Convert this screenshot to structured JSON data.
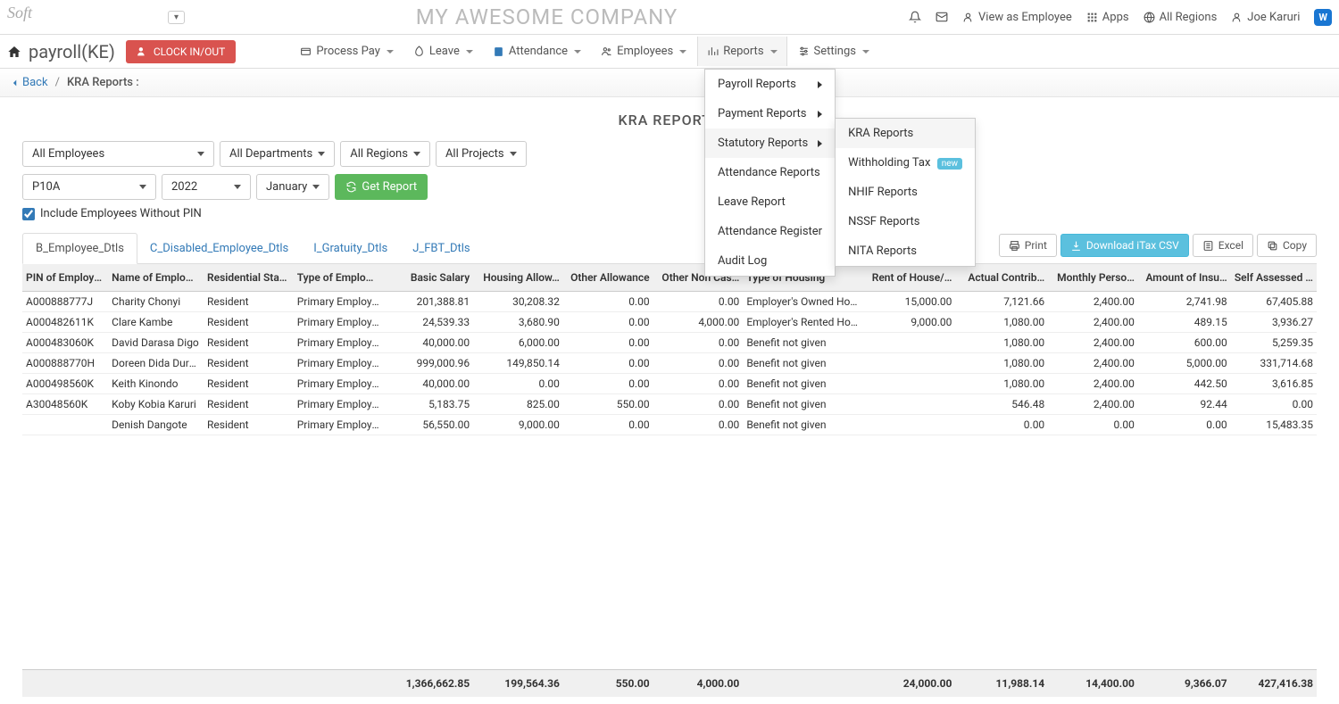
{
  "topbar": {
    "company": "MY AWESOME COMPANY",
    "view_as": "View as Employee",
    "apps": "Apps",
    "regions": "All Regions",
    "user": "Joe Karuri",
    "chat": "W"
  },
  "navbar": {
    "module": "payroll(KE)",
    "clock": "CLOCK IN/OUT",
    "menus": {
      "process": "Process Pay",
      "leave": "Leave",
      "attendance": "Attendance",
      "employees": "Employees",
      "reports": "Reports",
      "settings": "Settings"
    }
  },
  "dropdown": {
    "payroll_reports": "Payroll Reports",
    "payment_reports": "Payment Reports",
    "statutory_reports": "Statutory Reports",
    "attendance_reports": "Attendance Reports",
    "leave_report": "Leave Report",
    "attendance_register": "Attendance Register",
    "audit_log": "Audit Log",
    "sub": {
      "kra": "KRA Reports",
      "withholding": "Withholding Tax",
      "withholding_badge": "new",
      "nhif": "NHIF Reports",
      "nssf": "NSSF Reports",
      "nita": "NITA Reports"
    }
  },
  "breadcrumb": {
    "back": "Back",
    "current": "KRA Reports :"
  },
  "page_title": "KRA REPORTS",
  "filters": {
    "employees": "All Employees",
    "departments": "All Departments",
    "regions": "All Regions",
    "projects": "All Projects",
    "form": "P10A",
    "year": "2022",
    "month": "January",
    "get_report": "Get Report",
    "include_no_pin": "Include Employees Without PIN"
  },
  "tabs": {
    "b": "B_Employee_Dtls",
    "c": "C_Disabled_Employee_Dtls",
    "i": "I_Gratuity_Dtls",
    "j": "J_FBT_Dtls"
  },
  "actions": {
    "print": "Print",
    "download": "Download iTax CSV",
    "excel": "Excel",
    "copy": "Copy"
  },
  "table": {
    "headers": [
      "PIN of Employee",
      "Name of Emplo…",
      "Residential Sta…",
      "Type of Emplo…",
      "Basic Salary",
      "Housing Allow…",
      "Other Allowance",
      "Other Non Cas…",
      "Type of Housing",
      "Rent of House/…",
      "Actual Contrib…",
      "Monthly Perso…",
      "Amount of Insu…",
      "Self Assessed …"
    ],
    "rows": [
      [
        "A000888777J",
        "Charity Chonyi",
        "Resident",
        "Primary Employee",
        "201,388.81",
        "30,208.32",
        "0.00",
        "0.00",
        "Employer's Owned House",
        "15,000.00",
        "7,121.66",
        "2,400.00",
        "2,741.98",
        "67,405.88"
      ],
      [
        "A000482611K",
        "Clare Kambe",
        "Resident",
        "Primary Employee",
        "24,539.33",
        "3,680.90",
        "0.00",
        "4,000.00",
        "Employer's Rented House",
        "9,000.00",
        "1,080.00",
        "2,400.00",
        "489.15",
        "3,936.27"
      ],
      [
        "A000483060K",
        "David Darasa Digo",
        "Resident",
        "Primary Employee",
        "40,000.00",
        "6,000.00",
        "0.00",
        "0.00",
        "Benefit not given",
        "",
        "1,080.00",
        "2,400.00",
        "600.00",
        "5,259.35"
      ],
      [
        "A000888770H",
        "Doreen Dida Durush",
        "Resident",
        "Primary Employee",
        "999,000.96",
        "149,850.14",
        "0.00",
        "0.00",
        "Benefit not given",
        "",
        "1,080.00",
        "2,400.00",
        "5,000.00",
        "331,714.68"
      ],
      [
        "A000498560K",
        "Keith Kinondo",
        "Resident",
        "Primary Employee",
        "40,000.00",
        "0.00",
        "0.00",
        "0.00",
        "Benefit not given",
        "",
        "1,080.00",
        "2,400.00",
        "442.50",
        "3,616.85"
      ],
      [
        "A30048560K",
        "Koby Kobia Karuri",
        "Resident",
        "Primary Employee",
        "5,183.75",
        "825.00",
        "550.00",
        "0.00",
        "Benefit not given",
        "",
        "546.48",
        "2,400.00",
        "92.44",
        "0.00"
      ],
      [
        "",
        "Denish Dangote",
        "Resident",
        "Primary Employee",
        "56,550.00",
        "9,000.00",
        "0.00",
        "0.00",
        "Benefit not given",
        "",
        "0.00",
        "0.00",
        "0.00",
        "15,483.35"
      ]
    ],
    "totals": [
      "",
      "",
      "",
      "",
      "1,366,662.85",
      "199,564.36",
      "550.00",
      "4,000.00",
      "",
      "24,000.00",
      "11,988.14",
      "14,400.00",
      "9,366.07",
      "427,416.38"
    ]
  }
}
